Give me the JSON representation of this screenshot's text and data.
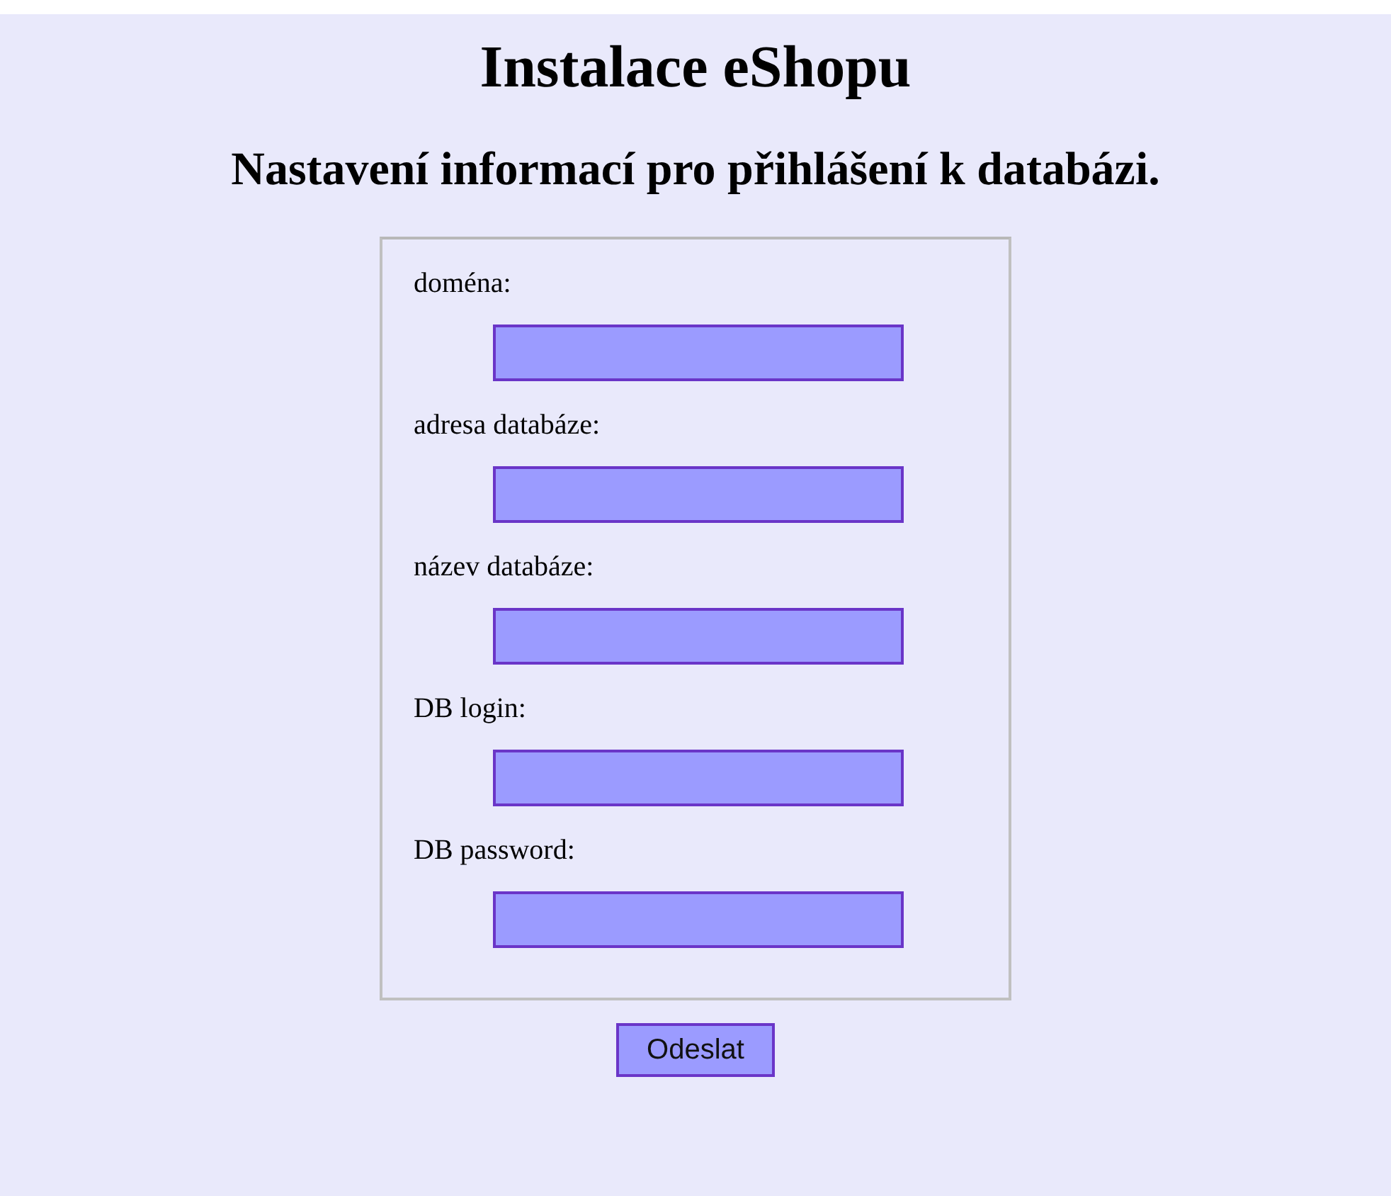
{
  "title": "Instalace eShopu",
  "subtitle": "Nastavení informací pro přihlášení k databázi.",
  "fields": [
    {
      "label": "doména:"
    },
    {
      "label": "adresa databáze:"
    },
    {
      "label": "název databáze:"
    },
    {
      "label": "DB login:"
    },
    {
      "label": "DB password:"
    }
  ],
  "submit": "Odeslat"
}
